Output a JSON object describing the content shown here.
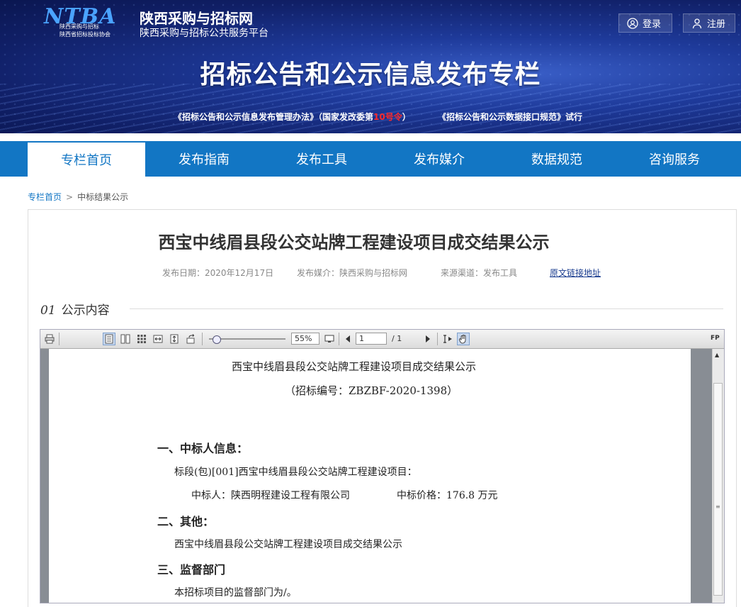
{
  "header": {
    "logo_mark": "NTBA",
    "logo_line1": "陕西采购与招标",
    "logo_line2": "陕西省招标投标协会",
    "site_name": "陕西采购与招标网",
    "site_sub": "陕西采购与招标公共服务平台",
    "login": "登录",
    "register": "注册",
    "title": "招标公告和公示信息发布专栏",
    "notice1_pre": "《招标公告和公示信息发布管理办法》（国家发改委第",
    "notice1_red": "10号令",
    "notice1_post": "）",
    "notice2": "《招标公告和公示数据接口规范》试行"
  },
  "nav": {
    "items": [
      "专栏首页",
      "发布指南",
      "发布工具",
      "发布媒介",
      "数据规范",
      "咨询服务"
    ],
    "active_index": 0
  },
  "breadcrumb": {
    "home": "专栏首页",
    "sep": ">",
    "current": "中标结果公示"
  },
  "article": {
    "title": "西宝中线眉县段公交站牌工程建设项目成交结果公示",
    "date": "发布日期：2020年12月17日",
    "media": "发布媒介：陕西采购与招标网",
    "source": "来源渠道：发布工具",
    "link": "原文链接地址"
  },
  "section": {
    "num": "01",
    "title": "公示内容"
  },
  "viewer": {
    "zoom": "55%",
    "page": "1",
    "total": "/ 1",
    "fp": "FP"
  },
  "pdf": {
    "title": "西宝中线眉县段公交站牌工程建设项目成交结果公示",
    "code": "（招标编号：ZBZBF-2020-1398）",
    "h1": "一、中标人信息：",
    "lot": "标段(包)[001]西宝中线眉县段公交站牌工程建设项目：",
    "winner": "中标人：陕西明程建设工程有限公司",
    "price": "中标价格：176.8 万元",
    "h2": "二、其他：",
    "other": "西宝中线眉县段公交站牌工程建设项目成交结果公示",
    "h3": "三、监督部门",
    "supervise": "本招标项目的监督部门为/。"
  },
  "colors": {
    "brand": "#1276c4",
    "banner": "#1e3a9a",
    "red": "#ff2a2a"
  }
}
